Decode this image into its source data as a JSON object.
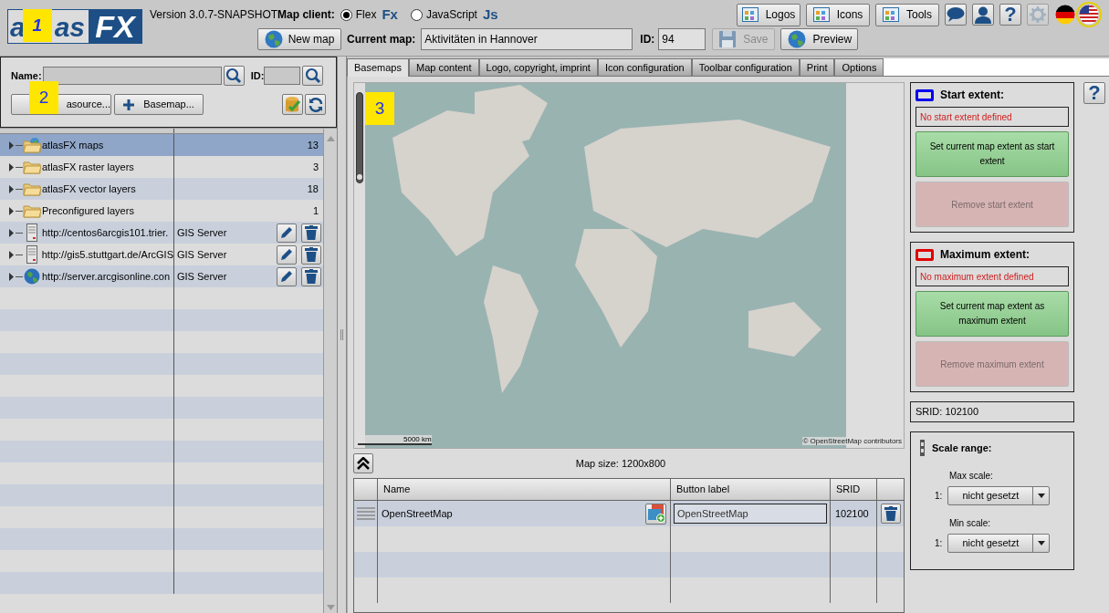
{
  "annotations": [
    {
      "label": "1"
    },
    {
      "label": "2"
    },
    {
      "label": "3"
    }
  ],
  "logo": {
    "parts": [
      "a",
      "as"
    ],
    "accent": "FX"
  },
  "version": "Version 3.0.7-SNAPSHOT",
  "map_client": {
    "label": "Map client:",
    "options": [
      {
        "label": "Flex",
        "badge": "Fx",
        "selected": true
      },
      {
        "label": "JavaScript",
        "badge": "Js",
        "selected": false
      }
    ]
  },
  "toolbar_buttons": [
    "Logos",
    "Icons",
    "Tools"
  ],
  "icon_buttons": [
    {
      "kind": "chat"
    },
    {
      "kind": "user"
    },
    {
      "kind": "help",
      "label": "?"
    },
    {
      "kind": "settings",
      "disabled": true
    }
  ],
  "languages": [
    {
      "kind": "de",
      "selected": false
    },
    {
      "kind": "us",
      "selected": true
    }
  ],
  "new_map_button": "New map",
  "current_map": {
    "label": "Current map:",
    "value": "Aktivitäten in Hannover"
  },
  "id_field": {
    "label": "ID:",
    "value": "94"
  },
  "save_button": {
    "label": "Save",
    "disabled": true
  },
  "preview_button": "Preview",
  "search": {
    "name_label": "Name:",
    "id_label": "ID:"
  },
  "add_buttons": [
    "asource...",
    "Basemap..."
  ],
  "tree": [
    {
      "kind": "map-folder",
      "name": "atlasFX maps",
      "count": "13",
      "editable": false,
      "selected": true
    },
    {
      "kind": "folder",
      "name": "atlasFX raster layers",
      "count": "3",
      "editable": false,
      "selected": false
    },
    {
      "kind": "folder",
      "name": "atlasFX vector layers",
      "count": "18",
      "editable": false,
      "selected": false
    },
    {
      "kind": "folder",
      "name": "Preconfigured layers",
      "count": "1",
      "editable": false,
      "selected": false
    },
    {
      "kind": "server",
      "name": "http://centos6arcgis101.trier.",
      "type": "GIS Server",
      "editable": true,
      "selected": false
    },
    {
      "kind": "server",
      "name": "http://gis5.stuttgart.de/ArcGIS",
      "type": "GIS Server",
      "editable": true,
      "selected": false
    },
    {
      "kind": "globe",
      "name": "http://server.arcgisonline.con",
      "type": "GIS Server",
      "editable": true,
      "selected": false
    }
  ],
  "tabs": [
    {
      "label": "Basemaps",
      "selected": true
    },
    {
      "label": "Map content",
      "selected": false
    },
    {
      "label": "Logo, copyright, imprint",
      "selected": false
    },
    {
      "label": "Icon configuration",
      "selected": false
    },
    {
      "label": "Toolbar configuration",
      "selected": false
    },
    {
      "label": "Print",
      "selected": false
    },
    {
      "label": "Options",
      "selected": false
    }
  ],
  "map": {
    "zoom": {
      "level": 0.03
    },
    "scale_label": "5000 km",
    "attribution": "© OpenStreetMap contributors"
  },
  "map_size": "Map size: 1200x800",
  "basemap_table": {
    "columns": [
      "Name",
      "Button label",
      "SRID"
    ],
    "rows": [
      {
        "name": "OpenStreetMap",
        "button_label": "OpenStreetMap",
        "srid": "102100"
      }
    ]
  },
  "extents": [
    {
      "title": "Start extent:",
      "color": "#0000ee",
      "status": "No start extent defined",
      "set_button": "Set current map extent as start extent",
      "remove_button": "Remove start extent",
      "remove_disabled": true
    },
    {
      "title": "Maximum extent:",
      "color": "#e00000",
      "status": "No maximum extent defined",
      "set_button": "Set current map extent as maximum extent",
      "remove_button": "Remove maximum extent",
      "remove_disabled": true
    }
  ],
  "srid": "SRID: 102100",
  "scale_range": {
    "title": "Scale range:",
    "scales": [
      {
        "label": "Max scale:",
        "prefix": "1:",
        "value": "nicht gesetzt"
      },
      {
        "label": "Min scale:",
        "prefix": "1:",
        "value": "nicht gesetzt"
      }
    ]
  },
  "help_button": "?"
}
